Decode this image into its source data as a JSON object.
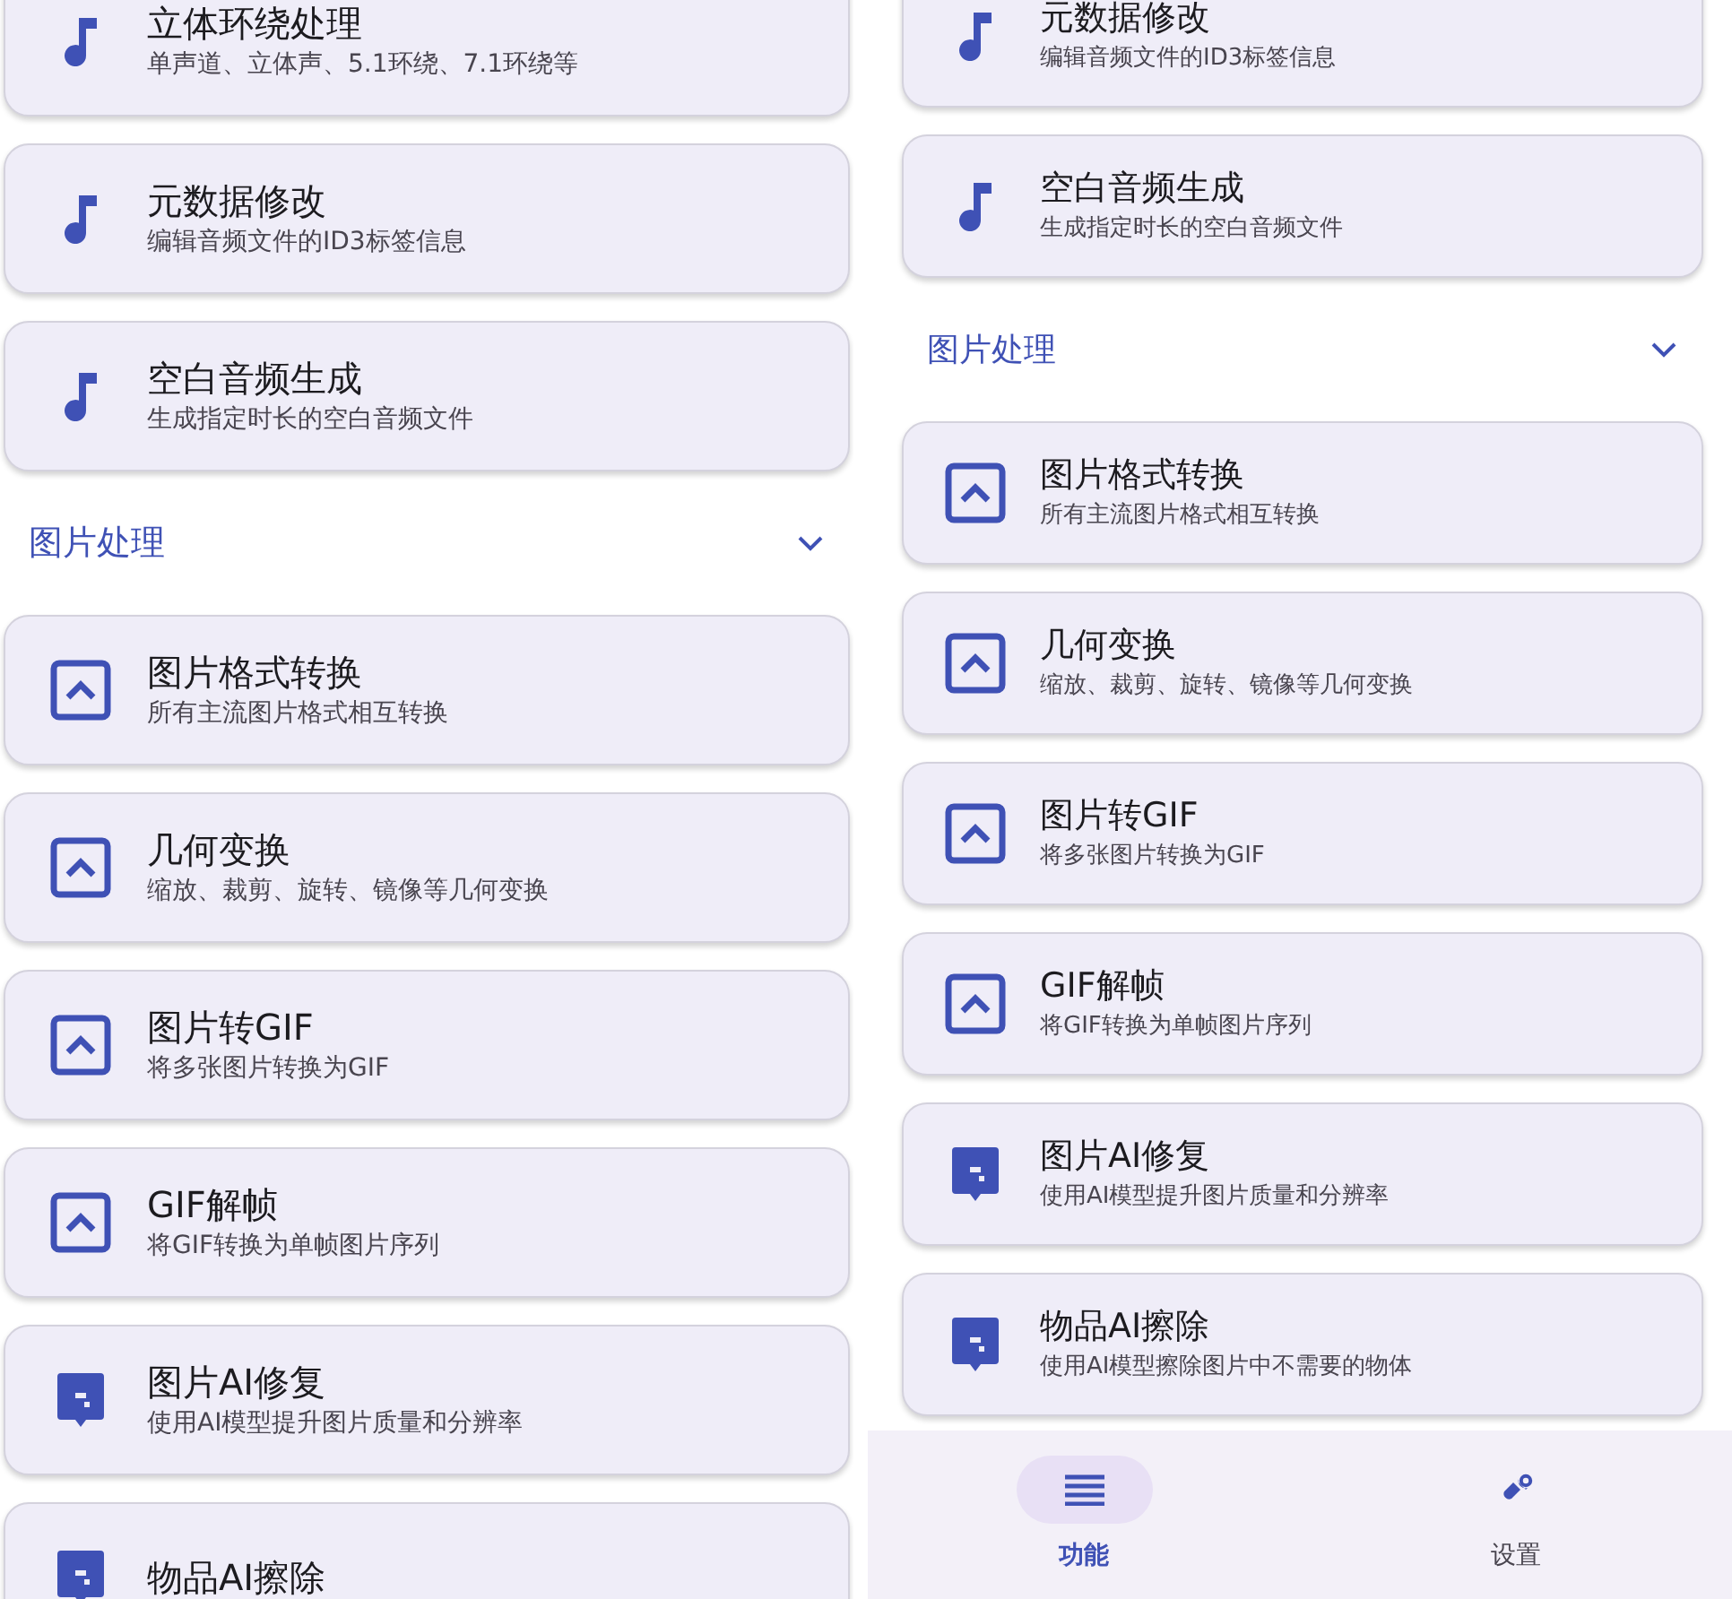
{
  "panels": [
    {
      "cards_before": [
        {
          "kind": "audio",
          "title": "立体环绕处理",
          "subtitle": "单声道、立体声、5.1环绕、7.1环绕等"
        },
        {
          "kind": "audio",
          "title": "元数据修改",
          "subtitle": "编辑音频文件的ID3标签信息"
        },
        {
          "kind": "audio",
          "title": "空白音频生成",
          "subtitle": "生成指定时长的空白音频文件"
        }
      ],
      "section": {
        "title": "图片处理",
        "expanded": true,
        "cards": [
          {
            "kind": "image",
            "title": "图片格式转换",
            "subtitle": "所有主流图片格式相互转换"
          },
          {
            "kind": "image",
            "title": "几何变换",
            "subtitle": "缩放、裁剪、旋转、镜像等几何变换"
          },
          {
            "kind": "image",
            "title": "图片转GIF",
            "subtitle": "将多张图片转换为GIF"
          },
          {
            "kind": "image",
            "title": "GIF解帧",
            "subtitle": "将GIF转换为单帧图片序列"
          },
          {
            "kind": "ai",
            "title": "图片AI修复",
            "subtitle": "使用AI模型提升图片质量和分辨率"
          },
          {
            "kind": "ai",
            "title": "物品AI擦除"
          }
        ]
      }
    },
    {
      "cards_before": [
        {
          "kind": "audio",
          "title": "元数据修改",
          "subtitle": "编辑音频文件的ID3标签信息"
        },
        {
          "kind": "audio",
          "title": "空白音频生成",
          "subtitle": "生成指定时长的空白音频文件"
        }
      ],
      "section": {
        "title": "图片处理",
        "expanded": true,
        "cards": [
          {
            "kind": "image",
            "title": "图片格式转换",
            "subtitle": "所有主流图片格式相互转换"
          },
          {
            "kind": "image",
            "title": "几何变换",
            "subtitle": "缩放、裁剪、旋转、镜像等几何变换"
          },
          {
            "kind": "image",
            "title": "图片转GIF",
            "subtitle": "将多张图片转换为GIF"
          },
          {
            "kind": "image",
            "title": "GIF解帧",
            "subtitle": "将GIF转换为单帧图片序列"
          },
          {
            "kind": "ai",
            "title": "图片AI修复",
            "subtitle": "使用AI模型提升图片质量和分辨率"
          },
          {
            "kind": "ai",
            "title": "物品AI擦除",
            "subtitle": "使用AI模型擦除图片中不需要的物体"
          }
        ]
      },
      "bottom_nav": [
        {
          "kind": "menu",
          "label": "功能",
          "selected": true
        },
        {
          "kind": "tools",
          "label": "设置",
          "selected": false
        }
      ]
    }
  ]
}
